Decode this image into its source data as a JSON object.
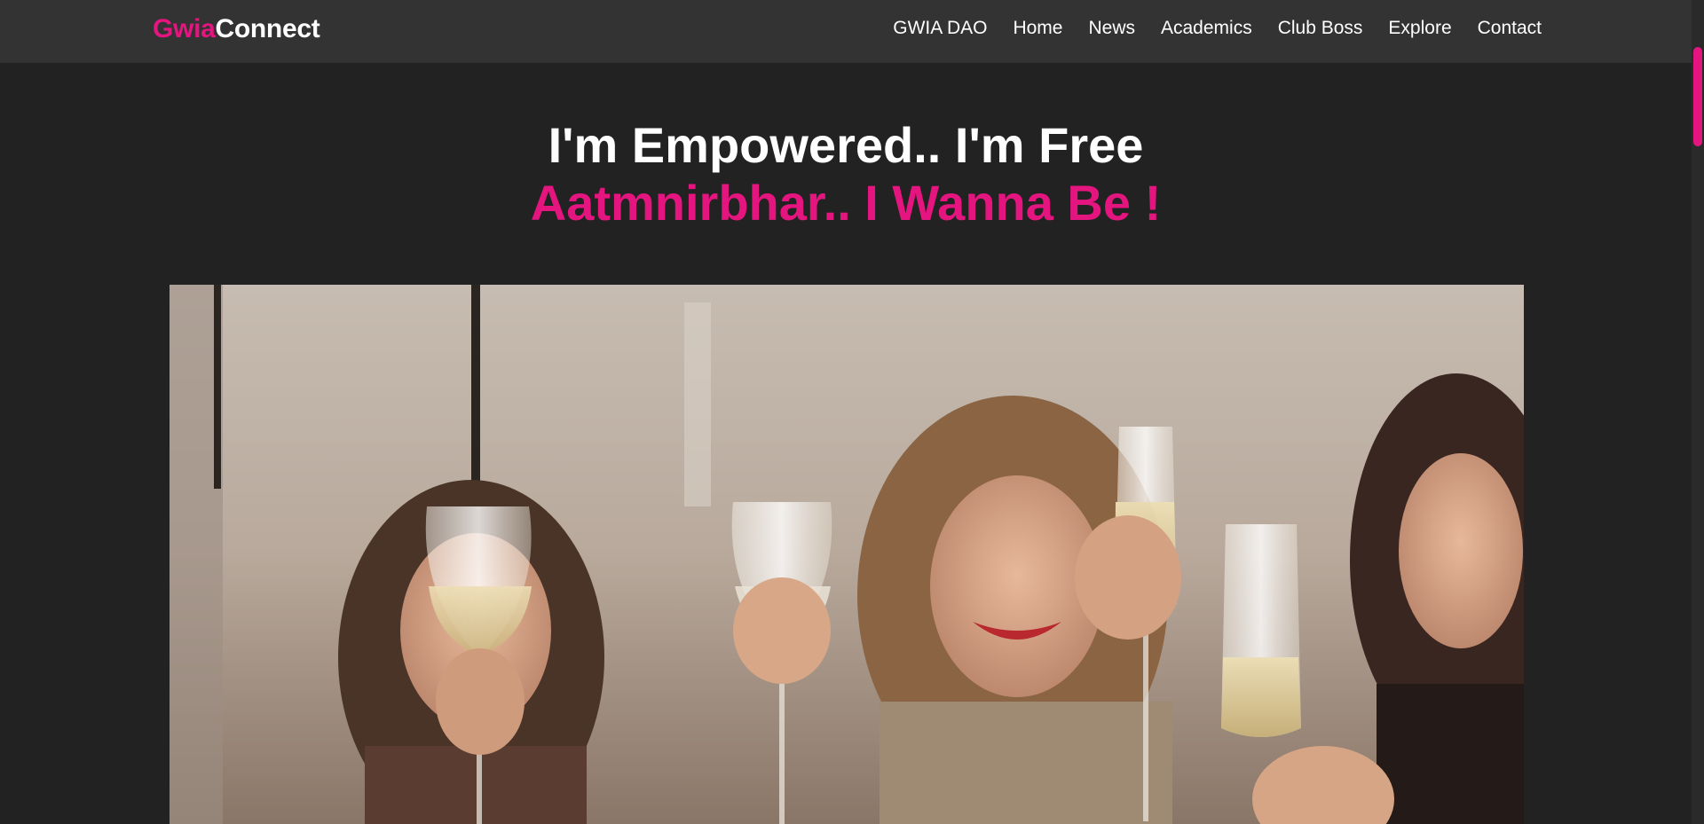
{
  "brand": {
    "part1": "Gwia",
    "part2": "Connect"
  },
  "nav": {
    "items": [
      {
        "label": "GWIA DAO"
      },
      {
        "label": "Home"
      },
      {
        "label": "News"
      },
      {
        "label": "Academics"
      },
      {
        "label": "Club Boss"
      },
      {
        "label": "Explore"
      },
      {
        "label": "Contact"
      }
    ]
  },
  "hero": {
    "title": "I'm Empowered.. I'm Free",
    "subtitle": "Aatmnirbhar.. I Wanna Be !"
  },
  "colors": {
    "accent": "#e5157f",
    "background": "#222222",
    "navbar": "#333333"
  }
}
